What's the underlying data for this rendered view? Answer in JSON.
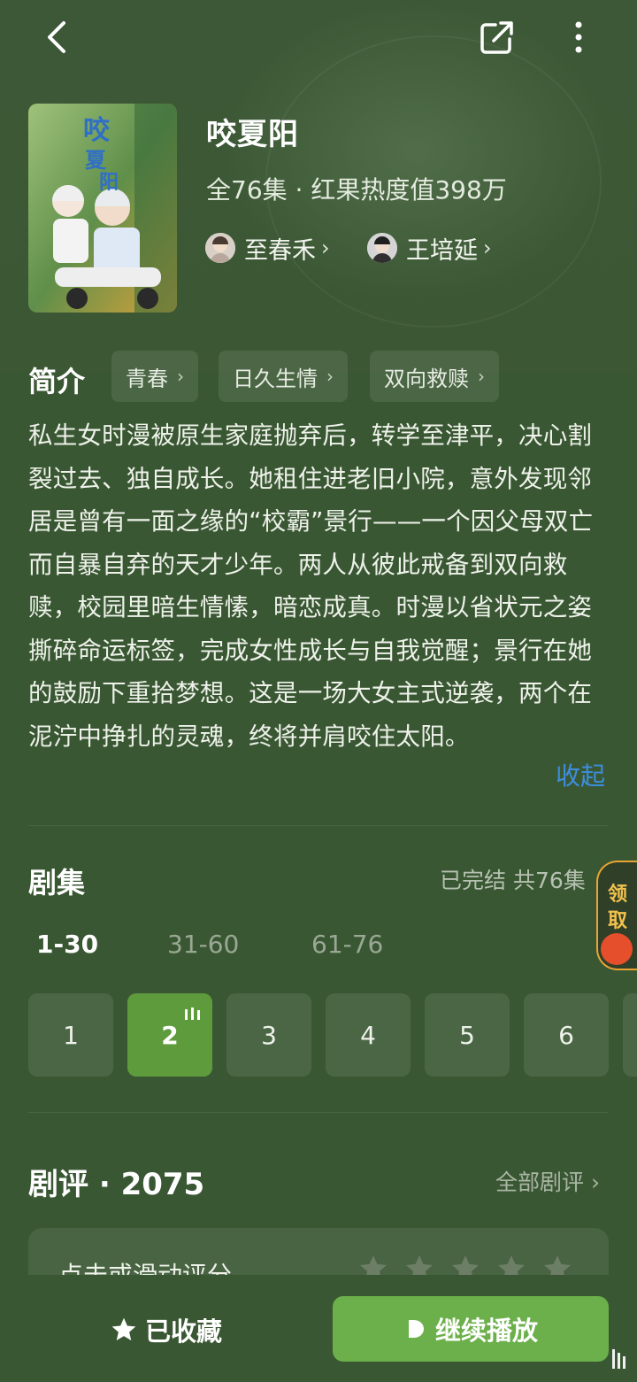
{
  "show": {
    "title": "咬夏阳",
    "meta": "全76集 · 红果热度值398万",
    "actors": [
      {
        "name": "至春禾"
      },
      {
        "name": "王培延"
      }
    ]
  },
  "intro": {
    "title": "简介",
    "tags": [
      "青春",
      "日久生情",
      "双向救赎"
    ],
    "synopsis": "私生女时漫被原生家庭抛弃后，转学至津平，决心割裂过去、独自成长。她租住进老旧小院，意外发现邻居是曾有一面之缘的“校霸”景行——一个因父母双亡而自暴自弃的天才少年。两人从彼此戒备到双向救赎，校园里暗生情愫，暗恋成真。时漫以省状元之姿撕碎命运标签，完成女性成长与自我觉醒；景行在她的鼓励下重拾梦想。这是一场大女主式逆袭，两个在泥泞中挣扎的灵魂，终将并肩咬住太阳。",
    "collapse_label": "收起"
  },
  "episodes": {
    "title": "剧集",
    "status": "已完结 共76集",
    "ranges": [
      "1-30",
      "31-60",
      "61-76"
    ],
    "active_range": "1-30",
    "items": [
      "1",
      "2",
      "3",
      "4",
      "5",
      "6"
    ],
    "current": "2"
  },
  "reward": {
    "label_1": "领",
    "label_2": "取"
  },
  "reviews": {
    "title": "剧评 · 2075",
    "all_label": "全部剧评",
    "rating_prompt": "点击或滑动评分",
    "stars": 5
  },
  "bottom": {
    "favorite_label": "已收藏",
    "play_label": "继续播放"
  },
  "colors": {
    "background": "#3a5733",
    "accent_green": "#6bb04a",
    "active_episode": "#5e9b3c",
    "link_blue": "#3c8ede",
    "reward_gold": "#e9a534"
  }
}
